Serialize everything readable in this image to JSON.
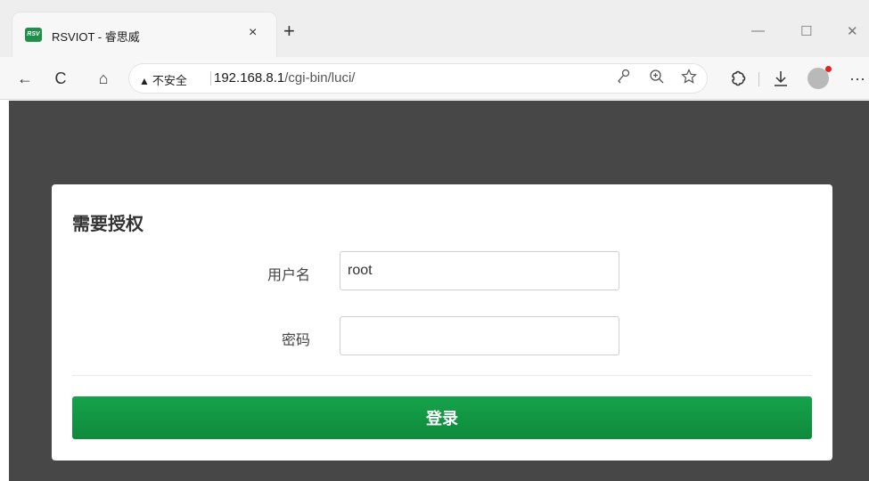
{
  "browser": {
    "tab": {
      "favicon_text": "RSV",
      "title": "RSVIOT - 睿思威",
      "close": "×"
    },
    "new_tab": "+",
    "window": {
      "minimize": "—",
      "maximize": "☐",
      "close": "✕"
    },
    "toolbar": {
      "back": "←",
      "reload": "C",
      "home": "⌂",
      "security_label": "不安全",
      "url_host": "192.168.8.1",
      "url_path": "/cgi-bin/luci/",
      "more": "···"
    }
  },
  "login": {
    "title": "需要授权",
    "username_label": "用户名",
    "username_value": "root",
    "password_label": "密码",
    "password_value": "",
    "submit_label": "登录"
  },
  "colors": {
    "page_bg": "#474747",
    "button": "#16a34a"
  }
}
